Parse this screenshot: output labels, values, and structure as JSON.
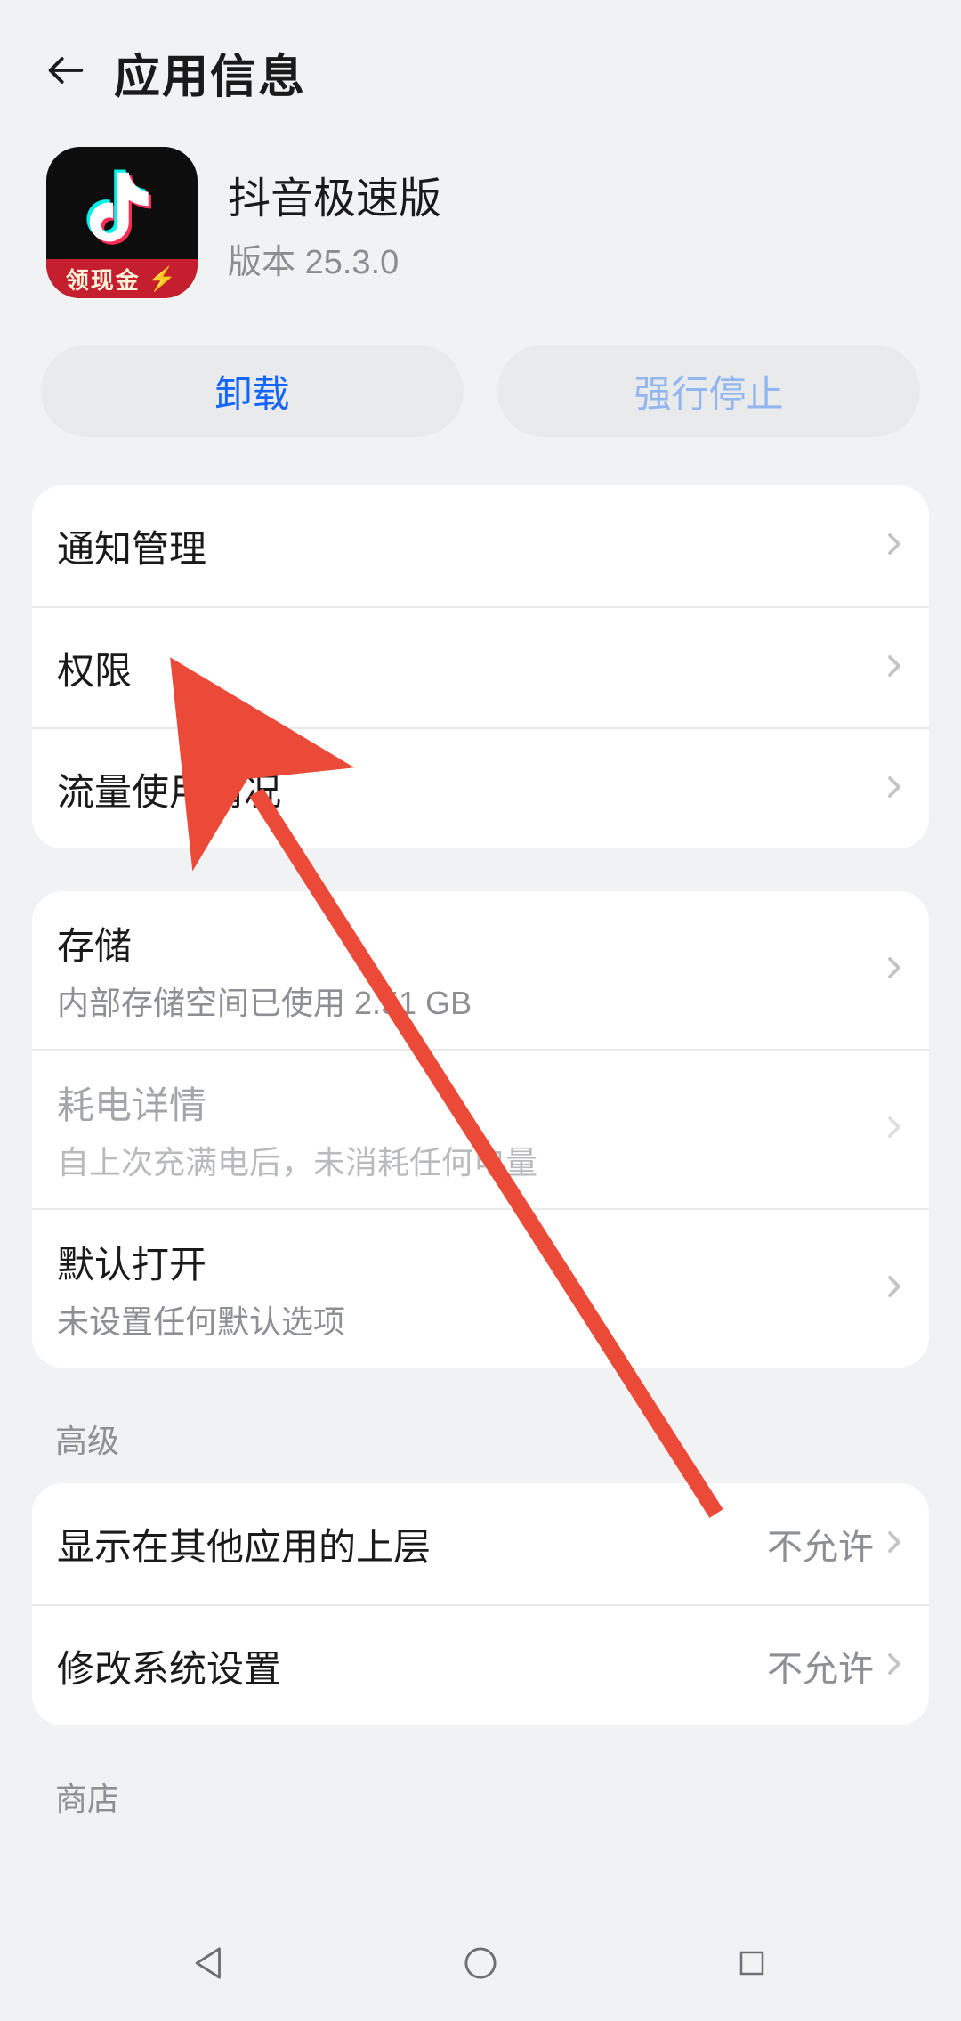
{
  "header": {
    "title": "应用信息"
  },
  "app": {
    "name": "抖音极速版",
    "version": "版本 25.3.0",
    "banner_text": "领现金"
  },
  "actions": {
    "uninstall": "卸载",
    "force_stop": "强行停止"
  },
  "group1": {
    "notifications": "通知管理",
    "permissions": "权限",
    "data_usage": "流量使用情况"
  },
  "group2": {
    "storage_title": "存储",
    "storage_sub": "内部存储空间已使用 2.51 GB",
    "battery_title": "耗电详情",
    "battery_sub": "自上次充满电后，未消耗任何电量",
    "open_default_title": "默认打开",
    "open_default_sub": "未设置任何默认选项"
  },
  "section_advanced": "高级",
  "group3": {
    "overlay_title": "显示在其他应用的上层",
    "overlay_value": "不允许",
    "modify_title": "修改系统设置",
    "modify_value": "不允许"
  },
  "section_store": "商店"
}
